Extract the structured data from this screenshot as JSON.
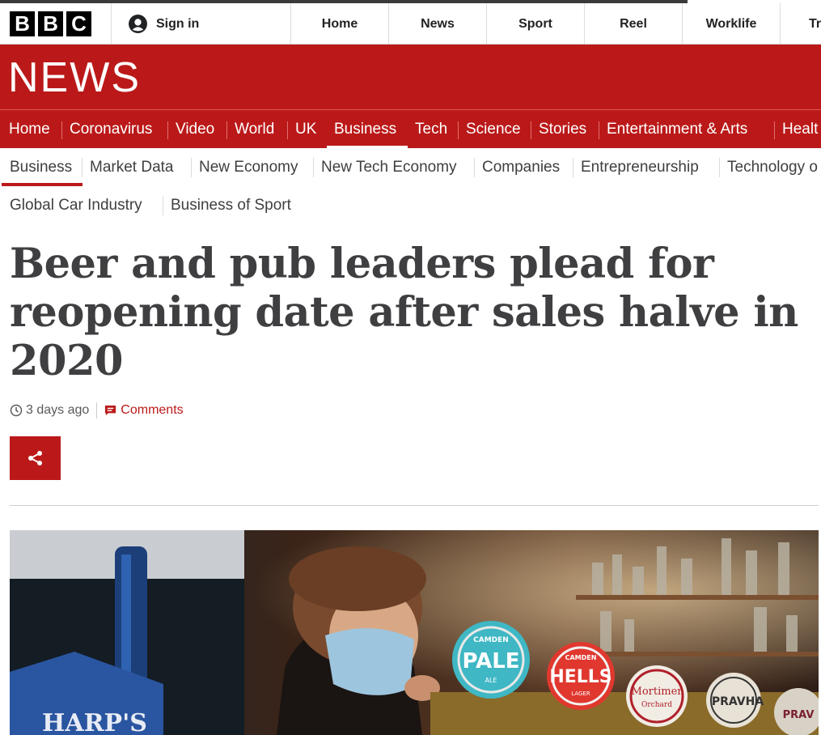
{
  "brand": {
    "letters": [
      "B",
      "B",
      "C"
    ]
  },
  "top_nav": {
    "sign_in": "Sign in",
    "items": [
      "Home",
      "News",
      "Sport",
      "Reel",
      "Worklife",
      "Tr"
    ]
  },
  "banner": {
    "title": "NEWS"
  },
  "section_nav": {
    "items": [
      "Home",
      "Coronavirus",
      "Video",
      "World",
      "UK",
      "Business",
      "Tech",
      "Science",
      "Stories",
      "Entertainment & Arts",
      "Healt"
    ],
    "active": "Business"
  },
  "sub_nav": {
    "row1": [
      "Business",
      "Market Data",
      "New Economy",
      "New Tech Economy",
      "Companies",
      "Entrepreneurship",
      "Technology o"
    ],
    "row2": [
      "Global Car Industry",
      "Business of Sport"
    ],
    "active": "Business"
  },
  "article": {
    "headline": "Beer and pub leaders plead for reopening date after sales halve in 2020",
    "timestamp": "3 days ago",
    "comments_label": "Comments"
  },
  "photo": {
    "tap_labels": [
      "CAMDEN",
      "PALE",
      "ALE",
      "CAMDEN",
      "HELLS",
      "LAGER",
      "Mortimer",
      "Orchard",
      "PRAVHA",
      "PRAV"
    ],
    "sign_text": "HARP'S"
  },
  "colors": {
    "brand_red": "#bb1919",
    "text": "#3f3f42"
  }
}
